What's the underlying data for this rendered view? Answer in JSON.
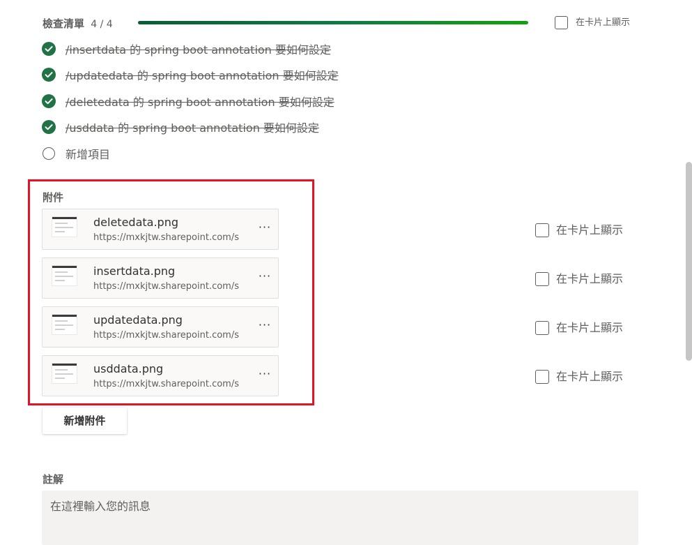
{
  "checklist": {
    "title": "檢查清單",
    "count": "4 / 4",
    "progress": 1.0,
    "show_on_card_label": "在卡片上顯示",
    "items": [
      {
        "text": "/insertdata 的 spring boot annotation 要如何設定",
        "done": true
      },
      {
        "text": "/updatedata 的 spring boot annotation 要如何設定",
        "done": true
      },
      {
        "text": "/deletedata 的 spring boot annotation 要如何設定",
        "done": true
      },
      {
        "text": "/usddata 的 spring boot annotation 要如何設定",
        "done": true
      }
    ],
    "add_item_label": "新增項目"
  },
  "attachments": {
    "title": "附件",
    "items": [
      {
        "name": "deletedata.png",
        "url": "https://mxkjtw.sharepoint.com/s",
        "show_on_card_label": "在卡片上顯示"
      },
      {
        "name": "insertdata.png",
        "url": "https://mxkjtw.sharepoint.com/s",
        "show_on_card_label": "在卡片上顯示"
      },
      {
        "name": "updatedata.png",
        "url": "https://mxkjtw.sharepoint.com/s",
        "show_on_card_label": "在卡片上顯示"
      },
      {
        "name": "usddata.png",
        "url": "https://mxkjtw.sharepoint.com/s",
        "show_on_card_label": "在卡片上顯示"
      }
    ],
    "more_label": "···",
    "add_button_label": "新增附件"
  },
  "comments": {
    "title": "註解",
    "placeholder": "在這裡輸入您的訊息"
  },
  "colors": {
    "check_green": "#217346",
    "progress_start": "#0b5d33",
    "progress_end": "#13a10e",
    "highlight_red": "#e81123"
  },
  "icons": {
    "done": "checkmark-circle-icon",
    "todo": "empty-circle-icon",
    "more": "more-horizontal-icon"
  }
}
